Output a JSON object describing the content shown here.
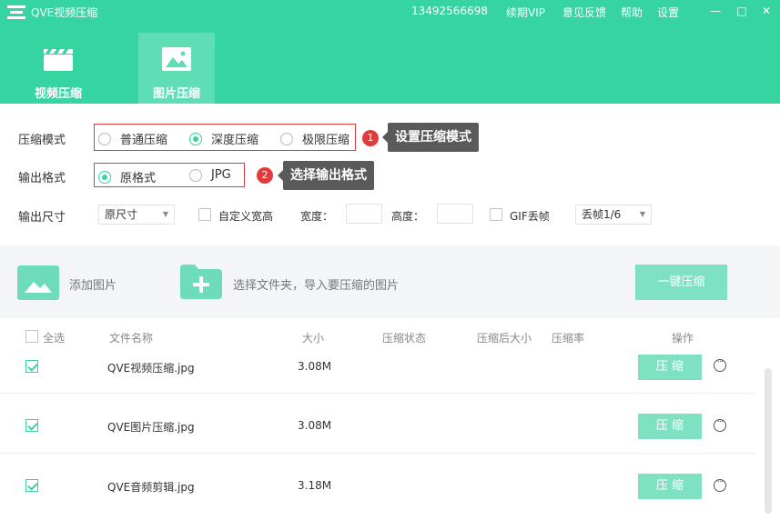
{
  "titlebar": {
    "app_title": "QVE视频压缩",
    "phone": "13492566698",
    "links": {
      "vip": "续期VIP",
      "feedback": "意见反馈",
      "help": "帮助",
      "settings": "设置"
    },
    "controls": {
      "minimize": "—",
      "maximize": "□",
      "close": "✕"
    }
  },
  "tabs": [
    {
      "label": "视频压缩",
      "icon": "clapperboard-icon",
      "active": false
    },
    {
      "label": "图片压缩",
      "icon": "image-icon",
      "active": true
    }
  ],
  "settings": {
    "mode": {
      "label": "压缩模式",
      "options": [
        "普通压缩",
        "深度压缩",
        "极限压缩"
      ],
      "selected": "深度压缩",
      "hint_number": "1",
      "hint_text": "设置压缩模式"
    },
    "format": {
      "label": "输出格式",
      "options": [
        "原格式",
        "JPG"
      ],
      "selected": "原格式",
      "hint_number": "2",
      "hint_text": "选择输出格式"
    },
    "size": {
      "label": "输出尺寸",
      "select_value": "原尺寸",
      "custom_label": "自定义宽高",
      "width_label": "宽度：",
      "height_label": "高度：",
      "gif_label": "GIF丢帧",
      "gif_select_value": "丢帧1/6"
    }
  },
  "toolbar": {
    "add_image": "添加图片",
    "add_folder": "选择文件夹，导入要压缩的图片",
    "compress_all": "一键压缩"
  },
  "table": {
    "headers": {
      "select_all": "全选",
      "name": "文件名称",
      "size": "大小",
      "status": "压缩状态",
      "after_size": "压缩后大小",
      "ratio": "压缩率",
      "action": "操作"
    },
    "rows": [
      {
        "name": "QVE视频压缩.jpg",
        "size": "3.08M",
        "button": "压 缩",
        "checked": true
      },
      {
        "name": "QVE图片压缩.jpg",
        "size": "3.08M",
        "button": "压 缩",
        "checked": true
      },
      {
        "name": "QVE音频剪辑.jpg",
        "size": "3.18M",
        "button": "压 缩",
        "checked": true
      }
    ]
  },
  "colors": {
    "accent": "#35d4a1",
    "button": "#7ee2c2",
    "callout": "#5a5a5a",
    "highlight": "#e23b3b"
  }
}
